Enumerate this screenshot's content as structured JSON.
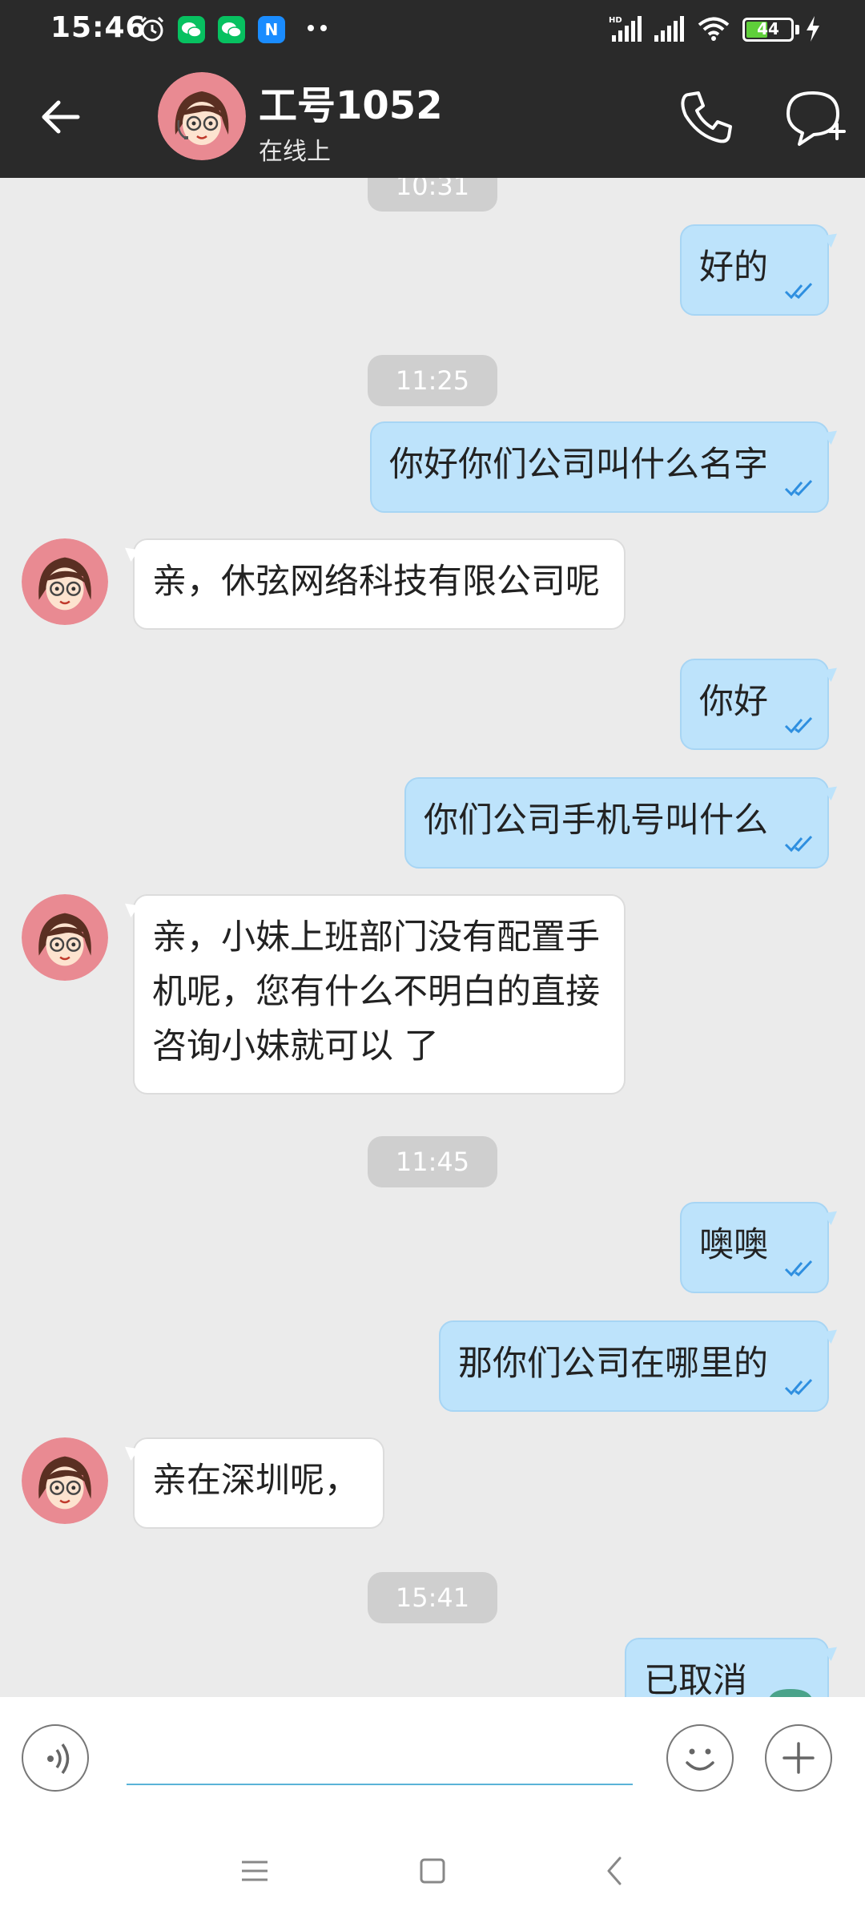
{
  "status_bar": {
    "time": "15:46",
    "battery_level": "44",
    "battery_fraction": 0.44,
    "icons": [
      "alarm-icon",
      "wechat-icon",
      "wechat-icon",
      "app-n-icon",
      "more-dots-icon",
      "hd-signal-icon",
      "signal-icon",
      "wifi-icon",
      "battery-icon",
      "charging-icon"
    ],
    "colors": {
      "background": "#2a2a2a",
      "wechat": "#07c160",
      "app_n": "#1a8cff",
      "battery": "#5fcf3a"
    }
  },
  "header": {
    "contact_name": "工号1052",
    "contact_status": "在线上",
    "icons": [
      "back-arrow-icon",
      "phone-icon",
      "add-chat-icon"
    ]
  },
  "messages": [
    {
      "type": "time",
      "text": "10:31"
    },
    {
      "type": "outgoing",
      "text": "好的",
      "read": true
    },
    {
      "type": "time",
      "text": "11:25"
    },
    {
      "type": "outgoing",
      "text": "你好你们公司叫什么名字",
      "read": true
    },
    {
      "type": "incoming",
      "text": "亲，休弦网络科技有限公司呢"
    },
    {
      "type": "outgoing",
      "text": "你好",
      "read": true
    },
    {
      "type": "outgoing",
      "text": "你们公司手机号叫什么",
      "read": true
    },
    {
      "type": "incoming",
      "lines": [
        "亲，小妹上班部门没有配置手",
        "机呢，您有什么不明白的直接",
        "咨询小妹就可以 了"
      ]
    },
    {
      "type": "time",
      "text": "11:45"
    },
    {
      "type": "outgoing",
      "text": "噢噢",
      "read": true
    },
    {
      "type": "outgoing",
      "text": "那你们公司在哪里的",
      "read": true
    },
    {
      "type": "incoming",
      "text": "亲在深圳呢，"
    },
    {
      "type": "time",
      "text": "15:41"
    },
    {
      "type": "outgoing-call",
      "text": "已取消",
      "icon": "cancelled-call-icon"
    }
  ],
  "input_bar": {
    "placeholder": "",
    "icons": [
      "voice-icon",
      "emoji-icon",
      "plus-icon"
    ]
  },
  "nav_bar": {
    "icons": [
      "menu-icon",
      "home-square-icon",
      "back-chevron-icon"
    ]
  },
  "colors": {
    "chat_background": "#ebebeb",
    "outgoing_bubble": "#bde3fb",
    "incoming_bubble": "#ffffff",
    "time_pill": "#cfcfcf",
    "read_tick": "#2e8fe0",
    "input_underline": "#5ab3d8"
  }
}
